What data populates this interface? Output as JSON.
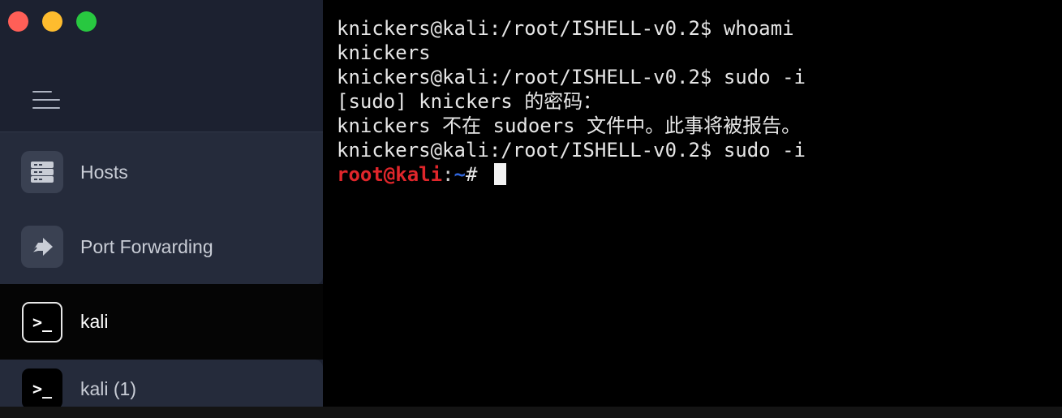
{
  "window": {
    "traffic_lights": [
      "close",
      "minimize",
      "maximize"
    ],
    "colors": {
      "close": "#ff5f57",
      "minimize": "#febc2e",
      "maximize": "#28c840"
    }
  },
  "sidebar": {
    "menu_icon": "hamburger-menu-icon",
    "nav": [
      {
        "label": "Hosts",
        "icon": "server-icon"
      },
      {
        "label": "Port Forwarding",
        "icon": "port-forward-arrow-icon"
      }
    ],
    "hosts": [
      {
        "label": "kali",
        "icon": "terminal-icon",
        "active": true
      },
      {
        "label": "kali (1)",
        "icon": "terminal-icon",
        "active": false
      }
    ],
    "term_icon_glyph": ">_"
  },
  "terminal": {
    "lines": [
      "knickers@kali:/root/ISHELL-v0.2$ whoami",
      "knickers",
      "knickers@kali:/root/ISHELL-v0.2$ sudo -i",
      "[sudo] knickers 的密码：",
      "knickers 不在 sudoers 文件中。此事将被报告。",
      "knickers@kali:/root/ISHELL-v0.2$ sudo -i"
    ],
    "root_prompt": {
      "user": "root@kali",
      "sep": ":",
      "path": "~",
      "symbol": "# "
    },
    "colors": {
      "root_user": "#e0262b",
      "path": "#2f64d8",
      "text": "#e6e6e6"
    }
  }
}
